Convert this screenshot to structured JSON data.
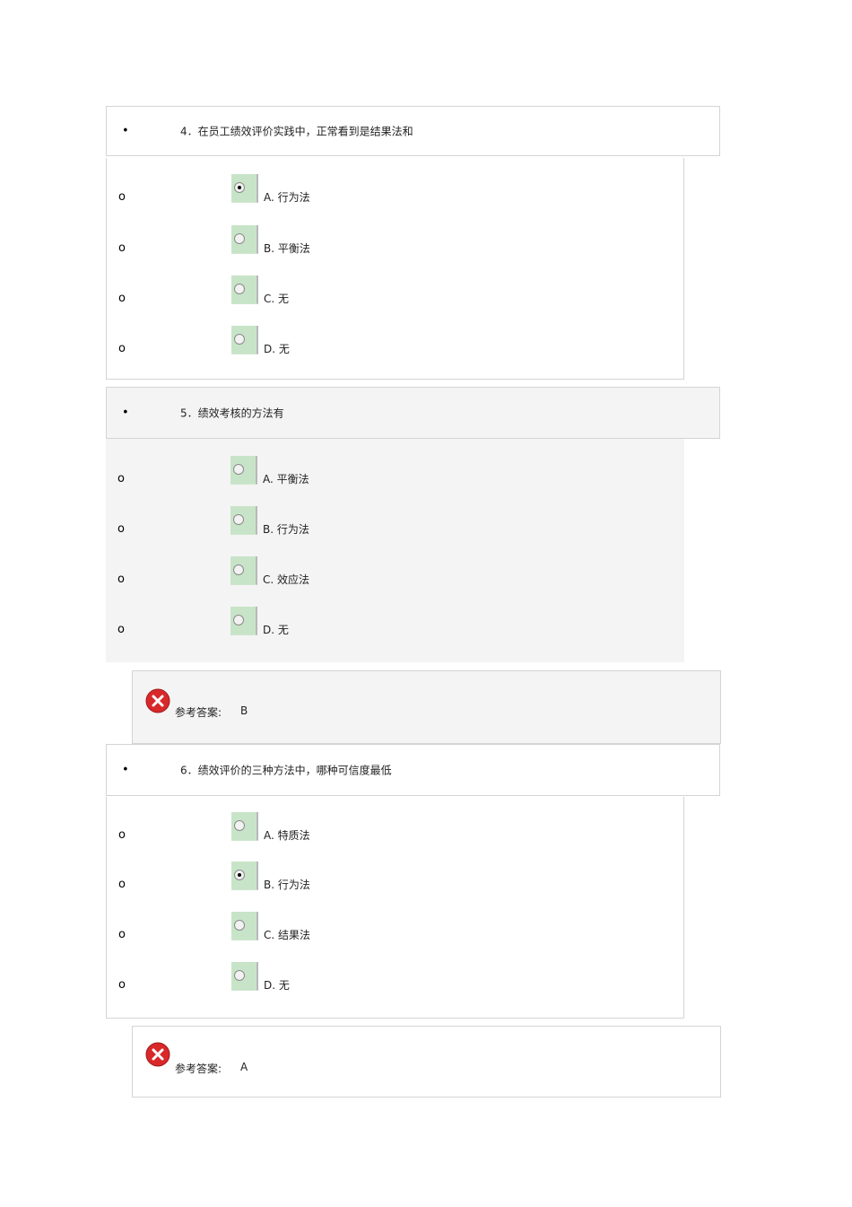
{
  "questions": [
    {
      "bullet": "•",
      "text": "4．在员工绩效评价实践中，正常看到是结果法和",
      "options": [
        {
          "marker": "o",
          "label": "A.  行为法",
          "selected": true
        },
        {
          "marker": "o",
          "label": "B.  平衡法",
          "selected": false
        },
        {
          "marker": "o",
          "label": "C.  无",
          "selected": false
        },
        {
          "marker": "o",
          "label": "D.  无",
          "selected": false
        }
      ]
    },
    {
      "bullet": "•",
      "text": "5．绩效考核的方法有",
      "options": [
        {
          "marker": "o",
          "label": "A.  平衡法",
          "selected": false
        },
        {
          "marker": "o",
          "label": "B.  行为法",
          "selected": false
        },
        {
          "marker": "o",
          "label": "C.  效应法",
          "selected": false
        },
        {
          "marker": "o",
          "label": "D.  无",
          "selected": false
        }
      ],
      "answer": {
        "label": "参考答案:",
        "value": "B",
        "icon": "red-x-icon"
      }
    },
    {
      "bullet": "•",
      "text": "6．绩效评价的三种方法中，哪种可信度最低",
      "options": [
        {
          "marker": "o",
          "label": "A.  特质法",
          "selected": false
        },
        {
          "marker": "o",
          "label": "B.  行为法",
          "selected": true
        },
        {
          "marker": "o",
          "label": "C.  结果法",
          "selected": false
        },
        {
          "marker": "o",
          "label": "D.  无",
          "selected": false
        }
      ],
      "answer": {
        "label": "参考答案:",
        "value": "A",
        "icon": "red-x-icon"
      }
    }
  ],
  "colors": {
    "radio_bg": "#c8e4c8",
    "gray_panel": "#f4f4f4",
    "border": "#d4d4d4",
    "wrong_icon": "#d8282a"
  }
}
